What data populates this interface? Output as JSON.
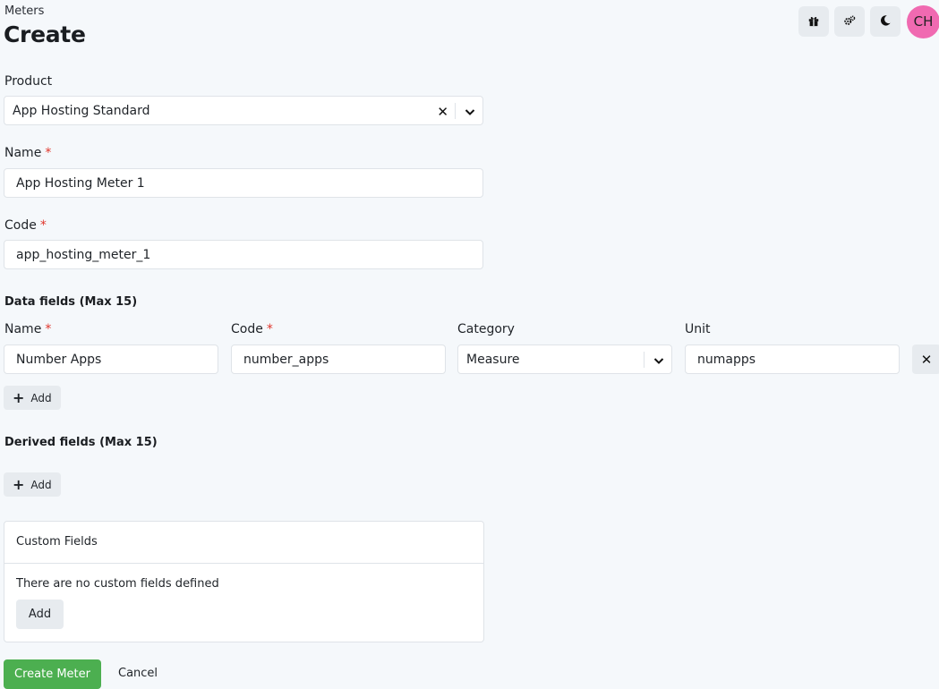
{
  "header": {
    "breadcrumb": "Meters",
    "title": "Create",
    "avatar_initials": "CH",
    "icons": [
      "gift-icon",
      "gears-icon",
      "moon-icon"
    ],
    "avatar_color": "#f06ab1"
  },
  "form": {
    "product": {
      "label": "Product",
      "value": "App Hosting Standard",
      "clear_glyph": "✕"
    },
    "name": {
      "label": "Name",
      "required_mark": "*",
      "value": "App Hosting Meter 1"
    },
    "code": {
      "label": "Code",
      "required_mark": "*",
      "value": "app_hosting_meter_1"
    }
  },
  "data_fields": {
    "title": "Data fields",
    "max_note": "(Max 15)",
    "columns": {
      "name": "Name",
      "code": "Code",
      "category": "Category",
      "unit": "Unit",
      "required_mark": "*"
    },
    "rows": [
      {
        "name": "Number Apps",
        "code": "number_apps",
        "category": "Measure",
        "unit": "numapps"
      }
    ],
    "add_label": "Add",
    "remove_glyph": "✕"
  },
  "derived_fields": {
    "title": "Derived fields",
    "max_note": "(Max 15)",
    "add_label": "Add"
  },
  "custom_fields": {
    "title": "Custom Fields",
    "empty_message": "There are no custom fields defined",
    "add_label": "Add"
  },
  "actions": {
    "submit_label": "Create Meter",
    "cancel_label": "Cancel",
    "submit_color": "#4caf50"
  }
}
